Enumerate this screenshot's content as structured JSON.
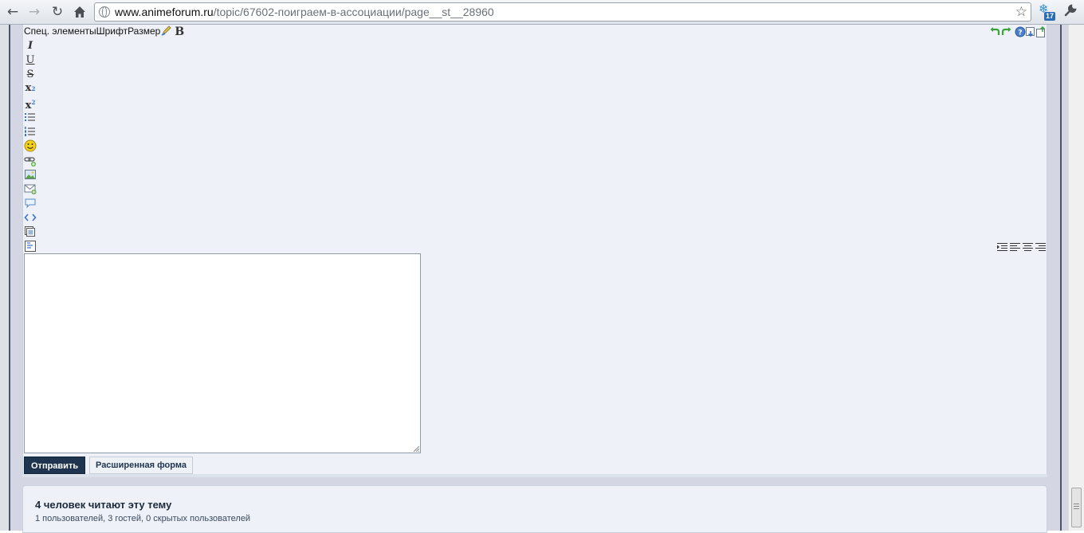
{
  "browser": {
    "url_host": "www.animeforum.ru",
    "url_path": "/topic/67602-поиграем-в-ассоциации/page__st__28960",
    "extension_badge": "17"
  },
  "editor": {
    "special_elements": "Спец. элементы",
    "font": "Шрифт",
    "size": "Размер"
  },
  "buttons": {
    "send": "Отправить",
    "advanced": "Расширенная форма"
  },
  "readers": {
    "title": "4 человек читают эту тему",
    "summary": "1 пользователей, 3 гостей, 0 скрытых пользователей"
  },
  "colors": {
    "send_button_bg": "#1e344f",
    "panel_bg": "#eef2f8",
    "page_bg": "#d5d6e3"
  }
}
